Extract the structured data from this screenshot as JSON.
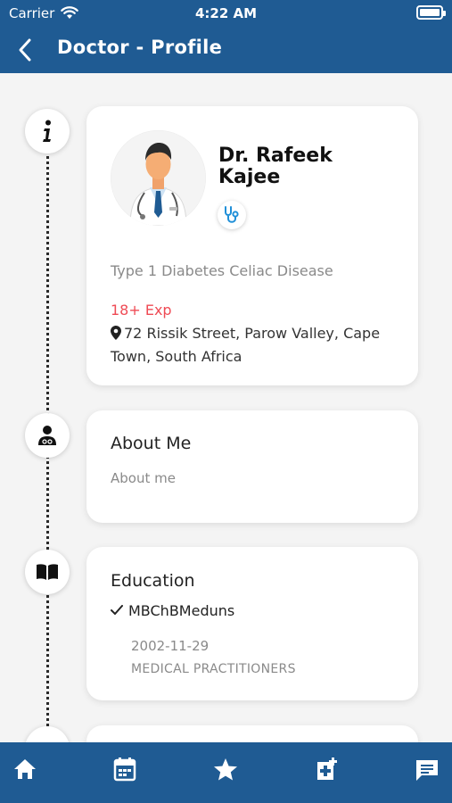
{
  "status_bar": {
    "carrier": "Carrier",
    "time": "4:22 AM"
  },
  "header": {
    "title": "Doctor - Profile",
    "back_icon": "chevron-left-icon"
  },
  "profile": {
    "name": "Dr. Rafeek Kajee",
    "specialty": "Type 1 Diabetes Celiac Disease",
    "experience": "18+ Exp",
    "address": "72 Rissik Street, Parow Valley, Cape Town, South Africa"
  },
  "about": {
    "title": "About Me",
    "text": "About me"
  },
  "education": {
    "title": "Education",
    "items": [
      {
        "degree": "MBChBMeduns",
        "date": "2002-11-29",
        "role": "MEDICAL PRACTITIONERS"
      }
    ]
  },
  "colors": {
    "primary": "#1f5b93",
    "accent_red": "#ef4b55",
    "background": "#f4f4f4"
  },
  "tabs": [
    "home-icon",
    "calendar-icon",
    "star-icon",
    "medical-add-icon",
    "chat-icon"
  ]
}
